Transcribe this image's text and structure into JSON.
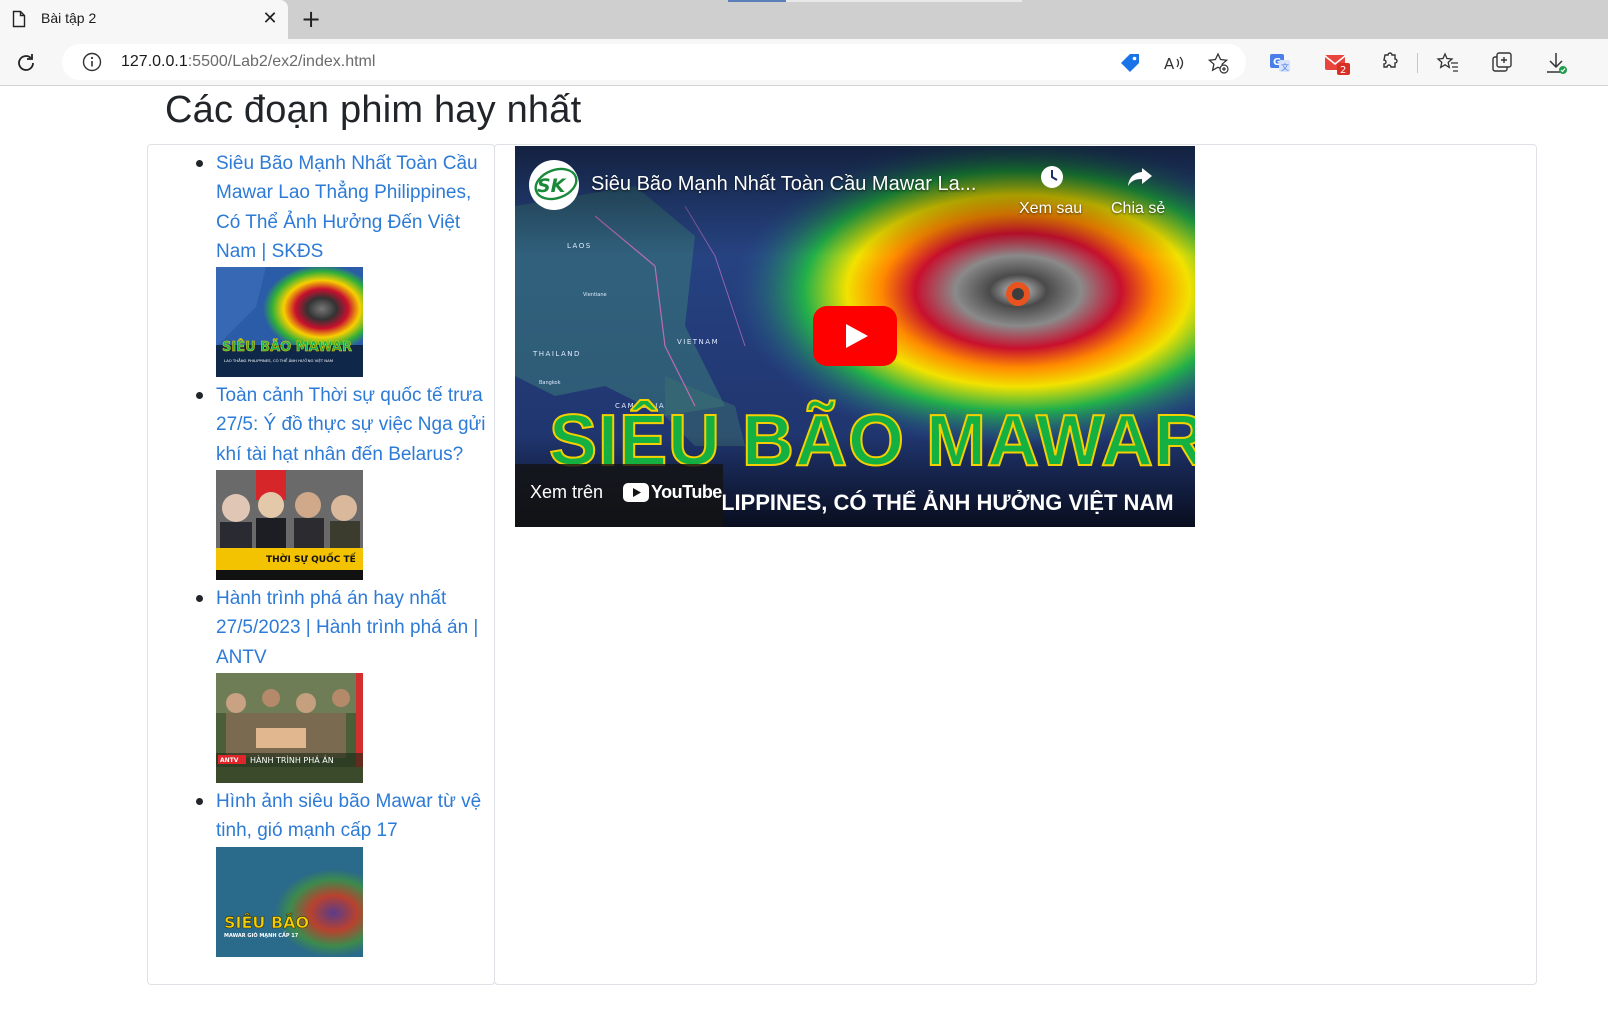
{
  "browser": {
    "tab_title": "Bài tập 2",
    "tab_close": "✕",
    "new_tab": "+",
    "url_host": "127.0.0.1",
    "url_path": ":5500/Lab2/ex2/index.html",
    "mail_badge": "2"
  },
  "page": {
    "title": "Các đoạn phim hay nhất"
  },
  "videos": [
    {
      "title": "Siêu Bão Mạnh Nhất Toàn Cầu Mawar Lao Thẳng Philippines, Có Thể Ảnh Hưởng Đến Việt Nam | SKĐS",
      "thumb_text": "SIÊU BÃO MAWAR",
      "thumb_sub": "LAO THẲNG PHILIPPINES, CÓ THỂ ẢNH HƯỞNG VIỆT NAM"
    },
    {
      "title": "Toàn cảnh Thời sự quốc tế trưa 27/5: Ý đồ thực sự việc Nga gửi khí tài hạt nhân đến Belarus?",
      "thumb_text": "THỜI SỰ QUỐC TẾ"
    },
    {
      "title": "Hành trình phá án hay nhất 27/5/2023 | Hành trình phá án | ANTV",
      "thumb_badge": "ANTV",
      "thumb_text": "HÀNH TRÌNH PHÁ ÁN"
    },
    {
      "title": "Hình ảnh siêu bão Mawar từ vệ tinh, gió mạnh cấp 17",
      "thumb_text": "SIÊU BÃO",
      "thumb_sub": "MAWAR GIÓ MẠNH CẤP 17"
    }
  ],
  "player": {
    "title": "Siêu Bão Mạnh Nhất Toàn Cầu Mawar La...",
    "channel": "SK",
    "watch_later": "Xem sau",
    "share": "Chia sẻ",
    "overlay_big": "SIÊU BÃO MAWAR",
    "overlay_sub": "LIPPINES, CÓ THỂ ẢNH HƯỞNG VIỆT NAM",
    "watch_on": "Xem trên",
    "youtube": "YouTube",
    "map_labels": [
      "LAOS",
      "Vientiane",
      "THAILAND",
      "Bangkok",
      "VIETNAM",
      "CAMBODIA"
    ]
  },
  "colors": {
    "link": "#2d7bd6",
    "youtube_red": "#ff0000",
    "overlay_green": "#14b042",
    "overlay_outline": "#f4d000"
  }
}
